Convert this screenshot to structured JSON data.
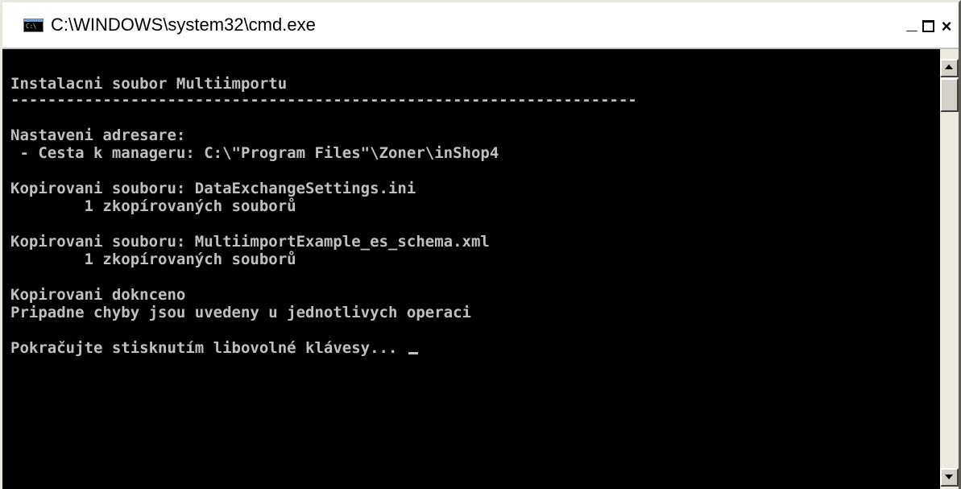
{
  "window": {
    "title": "C:\\WINDOWS\\system32\\cmd.exe",
    "icon": "cmd-icon",
    "icon_text": "C:\\",
    "controls": {
      "minimize": "_",
      "maximize": "maximize-icon",
      "close": "×"
    }
  },
  "console": {
    "lines": [
      "Instalacni soubor Multiimportu",
      "--------------------------------------------------------------------",
      "Nastaveni adresare:",
      " - Cesta k manageru: C:\\\"Program Files\"\\Zoner\\inShop4",
      "Kopirovani souboru: DataExchangeSettings.ini",
      "        1 zkopírovaných souborů",
      "Kopirovani souboru: MultiimportExample_es_schema.xml",
      "        1 zkopírovaných souborů",
      "Kopirovani doknceno",
      "Pripadne chyby jsou uvedeny u jednotlivych operaci",
      "Pokračujte stisknutím libovolné klávesy... "
    ]
  },
  "colors": {
    "console_bg": "#000000",
    "console_fg": "#c0c0c0",
    "titlebar_bg": "#ffffff",
    "frame": "#d4d0c8"
  }
}
